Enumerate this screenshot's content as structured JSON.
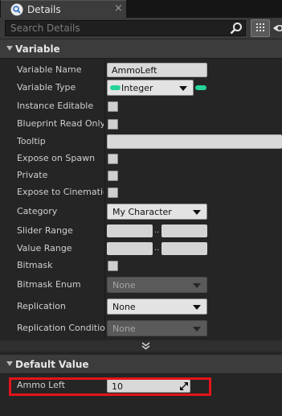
{
  "tab": {
    "title": "Details",
    "icon": "details-magnifier-icon",
    "close_icon": "close-icon",
    "close_glyph": "×"
  },
  "search": {
    "placeholder": "Search Details",
    "value": ""
  },
  "sections": {
    "variable": {
      "title": "Variable"
    },
    "default_value": {
      "title": "Default Value"
    }
  },
  "rows": {
    "variable_name": {
      "label": "Variable Name",
      "value": "AmmoLeft"
    },
    "variable_type": {
      "label": "Variable Type",
      "value": "Integer",
      "pill_color": "#25d39b"
    },
    "instance_editable": {
      "label": "Instance Editable",
      "checked": false
    },
    "blueprint_read_only": {
      "label": "Blueprint Read Only",
      "checked": false
    },
    "tooltip": {
      "label": "Tooltip",
      "value": ""
    },
    "expose_on_spawn": {
      "label": "Expose on Spawn",
      "checked": false
    },
    "private": {
      "label": "Private",
      "checked": false
    },
    "expose_to_cinematics": {
      "label": "Expose to Cinematics",
      "checked": false
    },
    "category": {
      "label": "Category",
      "value": "My Character"
    },
    "slider_range": {
      "label": "Slider Range",
      "min": "",
      "max": "",
      "separator": ".."
    },
    "value_range": {
      "label": "Value Range",
      "min": "",
      "max": "",
      "separator": ".."
    },
    "bitmask": {
      "label": "Bitmask",
      "checked": false
    },
    "bitmask_enum": {
      "label": "Bitmask Enum",
      "value": "None",
      "enabled": false
    },
    "replication": {
      "label": "Replication",
      "value": "None",
      "enabled": true
    },
    "replication_condition": {
      "label": "Replication Condition",
      "value": "None",
      "enabled": false
    }
  },
  "default_value": {
    "label": "Ammo Left",
    "value": "10"
  },
  "colors": {
    "highlight": "#e2141b",
    "panel_bg": "#252525",
    "header_bg": "#3c3c3c"
  }
}
